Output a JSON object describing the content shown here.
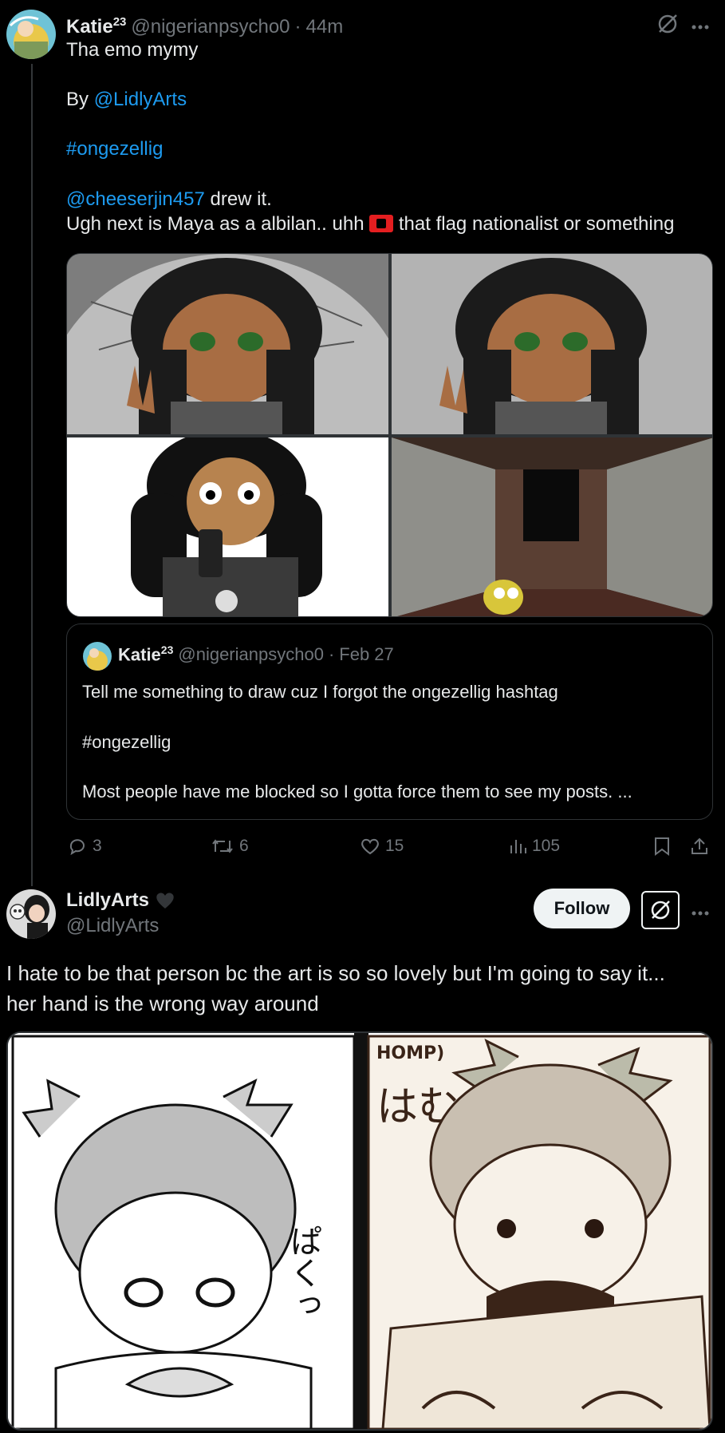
{
  "post1": {
    "display_name": "Katie",
    "superscript": "23",
    "handle": "@nigerianpsycho0",
    "separator": "·",
    "time": "44m",
    "text_line1": "Tha emo mymy",
    "by_prefix": "By ",
    "by_mention": "@LidlyArts",
    "hashtag": "#ongezellig",
    "credit_mention": "@cheeserjin457",
    "credit_suffix": " drew it.",
    "line_before_flag": "Ugh next is Maya as a albilan.. uhh ",
    "line_after_flag": " that flag nationalist or something",
    "quote": {
      "display_name": "Katie",
      "superscript": "23",
      "handle": "@nigerianpsycho0",
      "separator": "·",
      "date": "Feb 27",
      "line1": "Tell me something to draw cuz I forgot the ongezellig hashtag",
      "line2": "#ongezellig",
      "line3": "Most people have me blocked so I gotta force them to see my posts. ..."
    },
    "actions": {
      "replies": "3",
      "reposts": "6",
      "likes": "15",
      "views": "105"
    }
  },
  "post2": {
    "display_name": "LidlyArts",
    "handle": "@LidlyArts",
    "follow_label": "Follow",
    "text_line1": "I hate to be that person bc the art is so so lovely but I'm going to say it...",
    "text_line2": "her hand is the wrong way around",
    "manga_left_sfx": "ぱくっ",
    "manga_right_sfx_jp": "はむ",
    "manga_right_sfx_en": "HOMP)"
  },
  "colors": {
    "background": "#000000",
    "text": "#e7e9ea",
    "muted": "#71767b",
    "link": "#1d9bf0",
    "border": "#2f3336"
  },
  "icons": [
    "grok-icon",
    "more-icon",
    "reply-icon",
    "repost-icon",
    "like-icon",
    "views-icon",
    "bookmark-icon",
    "share-icon",
    "black-heart-icon",
    "albania-flag-icon"
  ]
}
